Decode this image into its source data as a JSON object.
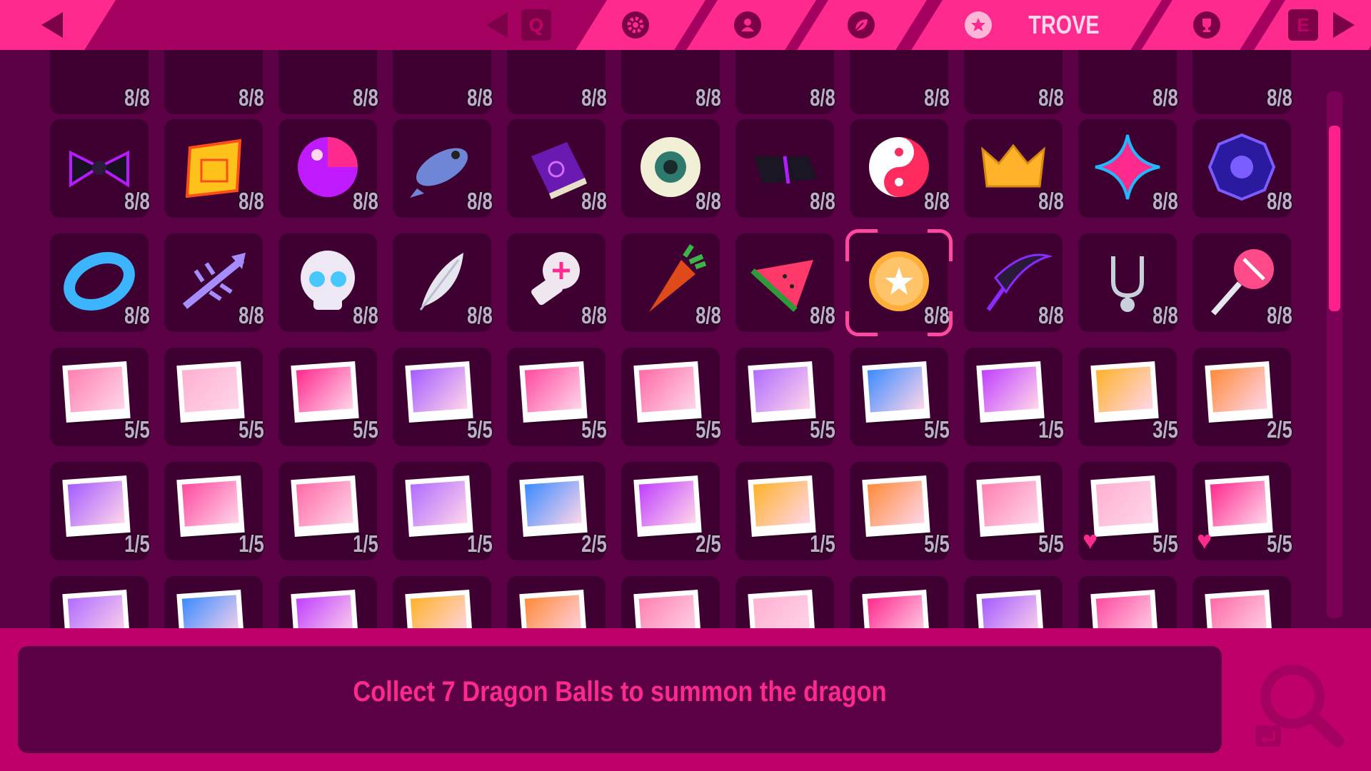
{
  "topbar": {
    "key_left": "Q",
    "key_right": "E",
    "active_tab_label": "TROVE",
    "tabs": [
      {
        "icon": "gear-icon"
      },
      {
        "icon": "profile-icon"
      },
      {
        "icon": "leaf-icon"
      },
      {
        "icon": "star-icon",
        "label": "TROVE",
        "active": true
      },
      {
        "icon": "trophy-icon"
      }
    ]
  },
  "grid": {
    "rows": [
      {
        "items": [
          {
            "icon": "partial-item",
            "count": "8/8"
          },
          {
            "icon": "partial-item",
            "count": "8/8"
          },
          {
            "icon": "partial-item",
            "count": "8/8"
          },
          {
            "icon": "partial-item",
            "count": "8/8"
          },
          {
            "icon": "partial-item",
            "count": "8/8"
          },
          {
            "icon": "partial-item",
            "count": "8/8"
          },
          {
            "icon": "partial-item",
            "count": "8/8"
          },
          {
            "icon": "partial-item",
            "count": "8/8"
          },
          {
            "icon": "partial-item",
            "count": "8/8"
          },
          {
            "icon": "partial-item",
            "count": "8/8"
          },
          {
            "icon": "partial-item",
            "count": "8/8"
          }
        ]
      },
      {
        "items": [
          {
            "icon": "bow-tie-icon",
            "count": "8/8"
          },
          {
            "icon": "scroll-icon",
            "count": "8/8"
          },
          {
            "icon": "beach-ball-icon",
            "count": "8/8"
          },
          {
            "icon": "fish-icon",
            "count": "8/8"
          },
          {
            "icon": "spellbook-icon",
            "count": "8/8"
          },
          {
            "icon": "eyeball-icon",
            "count": "8/8"
          },
          {
            "icon": "black-bar-icon",
            "count": "8/8"
          },
          {
            "icon": "yin-yang-icon",
            "count": "8/8"
          },
          {
            "icon": "crown-icon",
            "count": "8/8"
          },
          {
            "icon": "sparkle-star-icon",
            "count": "8/8"
          },
          {
            "icon": "bagua-icon",
            "count": "8/8"
          }
        ]
      },
      {
        "items": [
          {
            "icon": "ring-icon",
            "count": "8/8"
          },
          {
            "icon": "fish-skeleton-icon",
            "count": "8/8"
          },
          {
            "icon": "skull-icon",
            "count": "8/8"
          },
          {
            "icon": "feather-icon",
            "count": "8/8"
          },
          {
            "icon": "screw-icon",
            "count": "8/8"
          },
          {
            "icon": "carrot-icon",
            "count": "8/8"
          },
          {
            "icon": "watermelon-icon",
            "count": "8/8"
          },
          {
            "icon": "dragon-ball-icon",
            "count": "8/8",
            "selected": true
          },
          {
            "icon": "scythe-icon",
            "count": "8/8"
          },
          {
            "icon": "stethoscope-icon",
            "count": "8/8"
          },
          {
            "icon": "lollipop-icon",
            "count": "8/8"
          }
        ]
      },
      {
        "items": [
          {
            "icon": "photo-icon",
            "count": "5/5"
          },
          {
            "icon": "photo-icon",
            "count": "5/5"
          },
          {
            "icon": "photo-icon",
            "count": "5/5"
          },
          {
            "icon": "photo-icon",
            "count": "5/5"
          },
          {
            "icon": "photo-icon",
            "count": "5/5"
          },
          {
            "icon": "photo-icon",
            "count": "5/5"
          },
          {
            "icon": "photo-icon",
            "count": "5/5"
          },
          {
            "icon": "photo-icon",
            "count": "5/5"
          },
          {
            "icon": "photo-icon",
            "count": "1/5"
          },
          {
            "icon": "photo-icon",
            "count": "3/5"
          },
          {
            "icon": "photo-icon",
            "count": "2/5"
          }
        ]
      },
      {
        "items": [
          {
            "icon": "photo-icon",
            "count": "1/5"
          },
          {
            "icon": "photo-icon",
            "count": "1/5"
          },
          {
            "icon": "photo-icon",
            "count": "1/5"
          },
          {
            "icon": "photo-icon",
            "count": "1/5"
          },
          {
            "icon": "photo-icon",
            "count": "2/5"
          },
          {
            "icon": "photo-icon",
            "count": "2/5"
          },
          {
            "icon": "photo-icon",
            "count": "1/5"
          },
          {
            "icon": "photo-icon",
            "count": "5/5"
          },
          {
            "icon": "photo-icon",
            "count": "5/5"
          },
          {
            "icon": "photo-icon",
            "count": "5/5",
            "heart": true
          },
          {
            "icon": "photo-icon",
            "count": "5/5",
            "heart": true
          }
        ]
      },
      {
        "items": [
          {
            "icon": "photo-icon"
          },
          {
            "icon": "photo-icon"
          },
          {
            "icon": "photo-icon"
          },
          {
            "icon": "photo-icon"
          },
          {
            "icon": "photo-icon"
          },
          {
            "icon": "photo-icon"
          },
          {
            "icon": "photo-icon"
          },
          {
            "icon": "photo-icon"
          },
          {
            "icon": "photo-icon"
          },
          {
            "icon": "photo-icon"
          },
          {
            "icon": "photo-icon"
          }
        ]
      }
    ]
  },
  "description": {
    "text": "Collect 7 Dragon Balls to summon the dragon"
  },
  "colors": {
    "accent": "#ff2a8d",
    "topbar": "#a3005f",
    "background": "#5b0045",
    "tile": "#3d0030",
    "bottom": "#c0006a"
  }
}
